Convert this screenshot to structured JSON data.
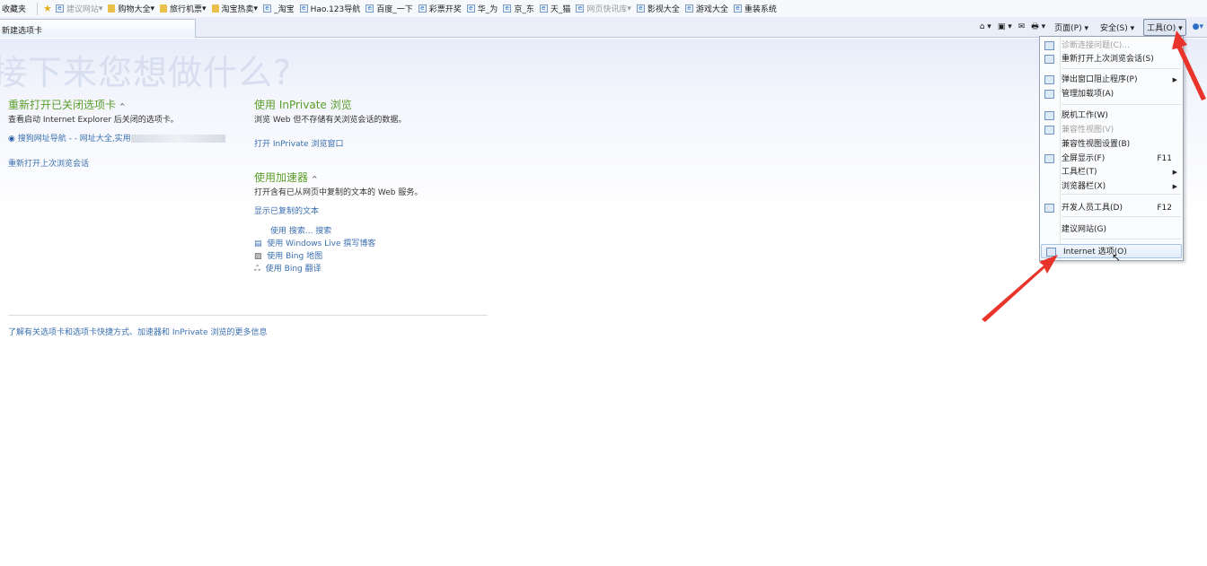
{
  "favorites": {
    "label": "收藏夹",
    "items": [
      {
        "label": "建议网站",
        "type": "ie",
        "dropdown": true,
        "dim": true
      },
      {
        "label": "购物大全",
        "type": "folder",
        "dropdown": true
      },
      {
        "label": "旅行机票",
        "type": "folder",
        "dropdown": true
      },
      {
        "label": "淘宝热卖",
        "type": "folder",
        "dropdown": true
      },
      {
        "label": "_淘宝",
        "type": "ie"
      },
      {
        "label": "Hao.123导航",
        "type": "ie"
      },
      {
        "label": "百度_一下",
        "type": "ie"
      },
      {
        "label": "彩票开奖",
        "type": "ie"
      },
      {
        "label": "华_为",
        "type": "ie"
      },
      {
        "label": "京_东",
        "type": "ie"
      },
      {
        "label": "天_猫",
        "type": "ie"
      },
      {
        "label": "网页快讯库",
        "type": "ie",
        "dropdown": true,
        "dim": true
      },
      {
        "label": "影视大全",
        "type": "ie"
      },
      {
        "label": "游戏大全",
        "type": "ie"
      },
      {
        "label": "重装系统",
        "type": "ie"
      }
    ]
  },
  "tab": {
    "label": "新建选项卡"
  },
  "commandbar": {
    "page": "页面(P)",
    "safety": "安全(S)",
    "tools": "工具(O)"
  },
  "page": {
    "title": "接下来您想做什么?",
    "reopen": {
      "heading": "重新打开已关闭选项卡",
      "desc": "查看启动 Internet Explorer 后关闭的选项卡。",
      "item": "搜狗网址导航 - - 网址大全,实用",
      "session_link": "重新打开上次浏览会话"
    },
    "inprivate": {
      "heading": "使用 InPrivate 浏览",
      "desc": "浏览 Web 但不存储有关浏览会话的数据。",
      "link": "打开 InPrivate 浏览窗口"
    },
    "accelerators": {
      "heading": "使用加速器",
      "desc": "打开含有已从网页中复制的文本的 Web 服务。",
      "show_link": "显示已复制的文本",
      "items": [
        "使用 搜索... 搜索",
        "使用 Windows Live 撰写博客",
        "使用 Bing 地图",
        "使用 Bing 翻译"
      ]
    },
    "footer_link": "了解有关选项卡和选项卡快捷方式、加速器和 InPrivate 浏览的更多信息"
  },
  "tools_menu": {
    "items": [
      {
        "label": "诊断连接问题(C)...",
        "disabled": true,
        "icon": "diagnose-icon"
      },
      {
        "label": "重新打开上次浏览会话(S)",
        "icon": "reopen-icon"
      },
      {
        "label": "弹出窗口阻止程序(P)",
        "submenu": true,
        "icon": "popup-icon"
      },
      {
        "label": "管理加载项(A)",
        "icon": "addons-icon"
      },
      {
        "label": "脱机工作(W)",
        "icon": "offline-icon"
      },
      {
        "label": "兼容性视图(V)",
        "disabled": true,
        "icon": "compat-icon"
      },
      {
        "label": "兼容性视图设置(B)"
      },
      {
        "label": "全屏显示(F)",
        "key": "F11",
        "icon": "fullscreen-icon"
      },
      {
        "label": "工具栏(T)",
        "submenu": true
      },
      {
        "label": "浏览器栏(X)",
        "submenu": true
      },
      {
        "label": "开发人员工具(D)",
        "key": "F12",
        "icon": "devtools-icon"
      },
      {
        "label": "建议网站(G)"
      },
      {
        "label": "Internet 选项(O)",
        "highlighted": true,
        "icon": "internet-options-icon"
      }
    ]
  },
  "colors": {
    "heading": "#5a9e2a",
    "link": "#3a6fb0",
    "arrow": "#e8342a"
  }
}
